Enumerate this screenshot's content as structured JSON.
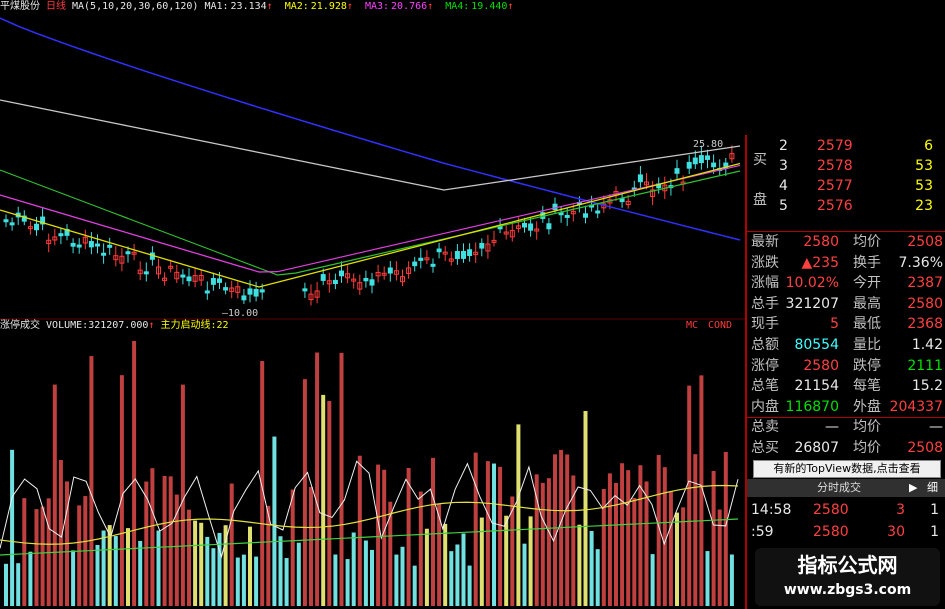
{
  "header": {
    "stock_name": "平煤股份",
    "period": "日线",
    "ma_def": "MA(5,10,20,30,60,120)",
    "ma": [
      {
        "label": "MA1:",
        "value": "23.134",
        "arrow": "↑",
        "color": "#e8e8e8"
      },
      {
        "label": "MA2:",
        "value": "21.928",
        "arrow": "↑",
        "color": "#ffff00"
      },
      {
        "label": "MA3:",
        "value": "20.766",
        "arrow": "↑",
        "color": "#ff40ff"
      },
      {
        "label": "MA4:",
        "value": "19.440",
        "arrow": "↑",
        "color": "#00e000"
      }
    ]
  },
  "price_chart": {
    "high_label": "25.80",
    "low_label": "10.00"
  },
  "volume_header": {
    "indicator_name": "涨停成交",
    "volume_label": "VOLUME:",
    "volume_value": "321207.000",
    "arrow": "↑",
    "main_line_label": "主力启动线:",
    "main_line_value": "22",
    "right_tag_1": "MC",
    "right_tag_2": "COND"
  },
  "order_book": {
    "side_label_1": "买",
    "side_label_2": "盘",
    "rows": [
      {
        "level": "2",
        "price": "2579",
        "volume": "6"
      },
      {
        "level": "3",
        "price": "2578",
        "volume": "53"
      },
      {
        "level": "4",
        "price": "2577",
        "volume": "53"
      },
      {
        "level": "5",
        "price": "2576",
        "volume": "23"
      }
    ]
  },
  "quote": {
    "rows": [
      {
        "l1": "最新",
        "v1": "2580",
        "c1": "#ff4040",
        "l2": "均价",
        "v2": "2508",
        "c2": "#ff4040"
      },
      {
        "l1": "涨跌",
        "v1": "▲235",
        "c1": "#ff4040",
        "l2": "换手",
        "v2": "7.36%",
        "c2": "#e8e8e8"
      },
      {
        "l1": "涨幅",
        "v1": "10.02%",
        "c1": "#ff4040",
        "l2": "今开",
        "v2": "2387",
        "c2": "#ff4040"
      },
      {
        "l1": "总手",
        "v1": "321207",
        "c1": "#e8e8e8",
        "l2": "最高",
        "v2": "2580",
        "c2": "#ff4040"
      },
      {
        "l1": "现手",
        "v1": "5",
        "c1": "#ff4040",
        "l2": "最低",
        "v2": "2368",
        "c2": "#ff4040"
      },
      {
        "l1": "总额",
        "v1": "80554",
        "c1": "#40ffff",
        "l2": "量比",
        "v2": "1.42",
        "c2": "#e8e8e8"
      },
      {
        "l1": "涨停",
        "v1": "2580",
        "c1": "#ff4040",
        "l2": "跌停",
        "v2": "2111",
        "c2": "#00e000"
      },
      {
        "l1": "总笔",
        "v1": "21154",
        "c1": "#e8e8e8",
        "l2": "每笔",
        "v2": "15.2",
        "c2": "#e8e8e8"
      },
      {
        "l1": "内盘",
        "v1": "116870",
        "c1": "#00e000",
        "l2": "外盘",
        "v2": "204337",
        "c2": "#ff4040"
      },
      {
        "l1": "总卖",
        "v1": "—",
        "c1": "#e8e8e8",
        "l2": "均价",
        "v2": "—",
        "c2": "#e8e8e8"
      },
      {
        "l1": "总买",
        "v1": "26807",
        "c1": "#e8e8e8",
        "l2": "均价",
        "v2": "2508",
        "c2": "#ff4040"
      }
    ]
  },
  "notice": "有新的TopView数据,点击查看",
  "ticks": {
    "title": "分时成交",
    "play_icon": "▶",
    "detail_label": "细",
    "rows": [
      {
        "time": "14:58",
        "price": "2580",
        "vol": "3",
        "count": "1"
      },
      {
        "time": ":59",
        "price": "2580",
        "vol": "30",
        "count": "1"
      }
    ]
  },
  "watermark": {
    "title": "指标公式网",
    "url": "www.zbgs3.com"
  }
}
